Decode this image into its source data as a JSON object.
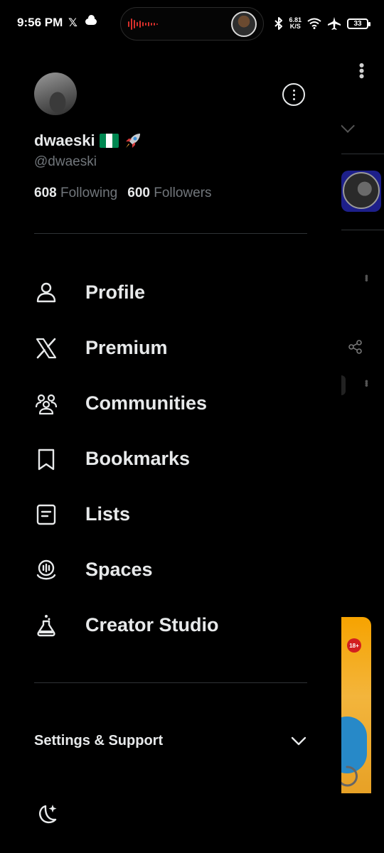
{
  "status_bar": {
    "time": "9:56 PM",
    "net_speed_value": "6.81",
    "net_speed_unit": "K/S",
    "battery": "33",
    "icons": [
      "x-logo-icon",
      "cloud-icon",
      "bluetooth-icon",
      "wifi-icon",
      "airplane-icon",
      "battery-icon"
    ]
  },
  "profile": {
    "display_name": "dwaeski",
    "handle": "@dwaeski",
    "following_count": "608",
    "following_label": "Following",
    "followers_count": "600",
    "followers_label": "Followers",
    "flag_colors": [
      "#008751",
      "#ffffff",
      "#008751"
    ]
  },
  "nav": {
    "items": [
      {
        "label": "Profile",
        "icon": "person-icon"
      },
      {
        "label": "Premium",
        "icon": "x-logo-icon"
      },
      {
        "label": "Communities",
        "icon": "communities-icon"
      },
      {
        "label": "Bookmarks",
        "icon": "bookmark-icon"
      },
      {
        "label": "Lists",
        "icon": "list-icon"
      },
      {
        "label": "Spaces",
        "icon": "spaces-icon"
      },
      {
        "label": "Creator Studio",
        "icon": "flask-icon"
      }
    ]
  },
  "settings": {
    "label": "Settings & Support"
  },
  "background": {
    "ad_badge": "18+"
  },
  "colors": {
    "background": "#000000",
    "text": "#e7e9ea",
    "secondary_text": "#71767b",
    "divider": "#2f3336"
  }
}
